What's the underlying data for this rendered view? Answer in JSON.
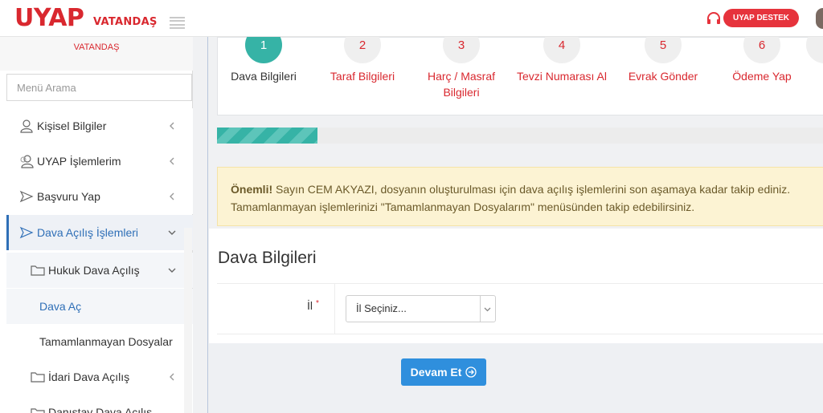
{
  "header": {
    "logo_text": "UYAP",
    "logo_sub": "VATANDAŞ",
    "support_label": "UYAP DESTEK"
  },
  "sidebar": {
    "user_label": "VATANDAŞ",
    "search_placeholder": "Menü Arama",
    "items": [
      {
        "label": "Kişisel Bilgiler",
        "icon": "user-icon"
      },
      {
        "label": "UYAP İşlemlerim",
        "icon": "users-icon"
      },
      {
        "label": "Başvuru Yap",
        "icon": "send-icon"
      },
      {
        "label": "Dava Açılış İşlemleri",
        "icon": "send-icon"
      },
      {
        "label": "Hukuk Dava Açılış",
        "icon": "folder-icon"
      },
      {
        "label": "Dava Aç"
      },
      {
        "label": "Tamamlanmayan Dosyalar"
      },
      {
        "label": "İdari Dava Açılış",
        "icon": "folder-icon"
      },
      {
        "label": "Danıştay Dava Açılış",
        "icon": "folder-icon"
      }
    ]
  },
  "wizard": {
    "steps": [
      {
        "number": "1",
        "label": "Dava Bilgileri"
      },
      {
        "number": "2",
        "label": "Taraf Bilgileri"
      },
      {
        "number": "3",
        "label_line1": "Harç / Masraf",
        "label_line2": "Bilgileri"
      },
      {
        "number": "4",
        "label": "Tevzi Numarası Al"
      },
      {
        "number": "5",
        "label": "Evrak Gönder"
      },
      {
        "number": "6",
        "label": "Ödeme Yap"
      }
    ],
    "progress_fraction": 0.165
  },
  "alert": {
    "strong": "Önemli!",
    "line1": " Sayın CEM AKYAZI, dosyanın oluşturulması için dava açılış işlemlerini son aşamaya kadar takip ediniz.",
    "line2": "Tamamlanmayan işlemlerinizi \"Tamamlanmayan Dosyalarım\" menüsünden takip edebilirsiniz."
  },
  "form": {
    "title": "Dava Bilgileri",
    "il_label": "İl",
    "il_required": "*",
    "il_value": "İl Seçiniz...",
    "submit_label": "Devam Et"
  },
  "colors": {
    "brand": "#d9282f",
    "accent": "#36b3a6",
    "button": "#2f8fdd",
    "link": "#2f6fb7"
  }
}
